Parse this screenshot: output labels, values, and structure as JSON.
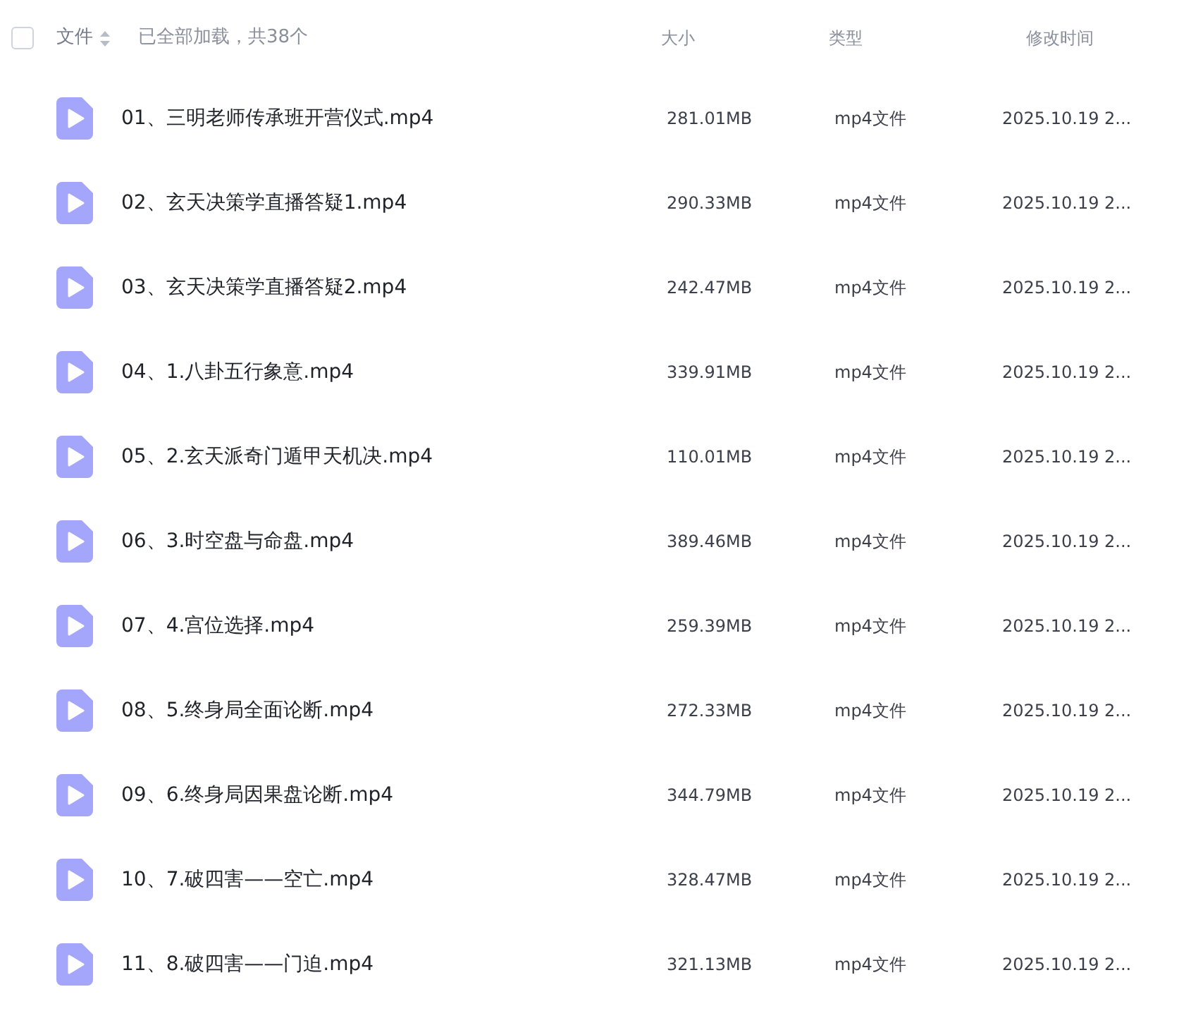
{
  "header": {
    "checked": false,
    "name_column": "文件",
    "status": "已全部加载，共38个",
    "size_column": "大小",
    "type_column": "类型",
    "date_column": "修改时间"
  },
  "files": [
    {
      "name": "01、三明老师传承班开营仪式.mp4",
      "size": "281.01MB",
      "type": "mp4文件",
      "modified": "2025.10.19 2..."
    },
    {
      "name": "02、玄天决策学直播答疑1.mp4",
      "size": "290.33MB",
      "type": "mp4文件",
      "modified": "2025.10.19 2..."
    },
    {
      "name": "03、玄天决策学直播答疑2.mp4",
      "size": "242.47MB",
      "type": "mp4文件",
      "modified": "2025.10.19 2..."
    },
    {
      "name": "04、1.八卦五行象意.mp4",
      "size": "339.91MB",
      "type": "mp4文件",
      "modified": "2025.10.19 2..."
    },
    {
      "name": "05、2.玄天派奇门遁甲天机决.mp4",
      "size": "110.01MB",
      "type": "mp4文件",
      "modified": "2025.10.19 2..."
    },
    {
      "name": "06、3.时空盘与命盘.mp4",
      "size": "389.46MB",
      "type": "mp4文件",
      "modified": "2025.10.19 2..."
    },
    {
      "name": "07、4.宫位选择.mp4",
      "size": "259.39MB",
      "type": "mp4文件",
      "modified": "2025.10.19 2..."
    },
    {
      "name": "08、5.终身局全面论断.mp4",
      "size": "272.33MB",
      "type": "mp4文件",
      "modified": "2025.10.19 2..."
    },
    {
      "name": "09、6.终身局因果盘论断.mp4",
      "size": "344.79MB",
      "type": "mp4文件",
      "modified": "2025.10.19 2..."
    },
    {
      "name": "10、7.破四害——空亡.mp4",
      "size": "328.47MB",
      "type": "mp4文件",
      "modified": "2025.10.19 2..."
    },
    {
      "name": "11、8.破四害——门迫.mp4",
      "size": "321.13MB",
      "type": "mp4文件",
      "modified": "2025.10.19 2..."
    }
  ]
}
